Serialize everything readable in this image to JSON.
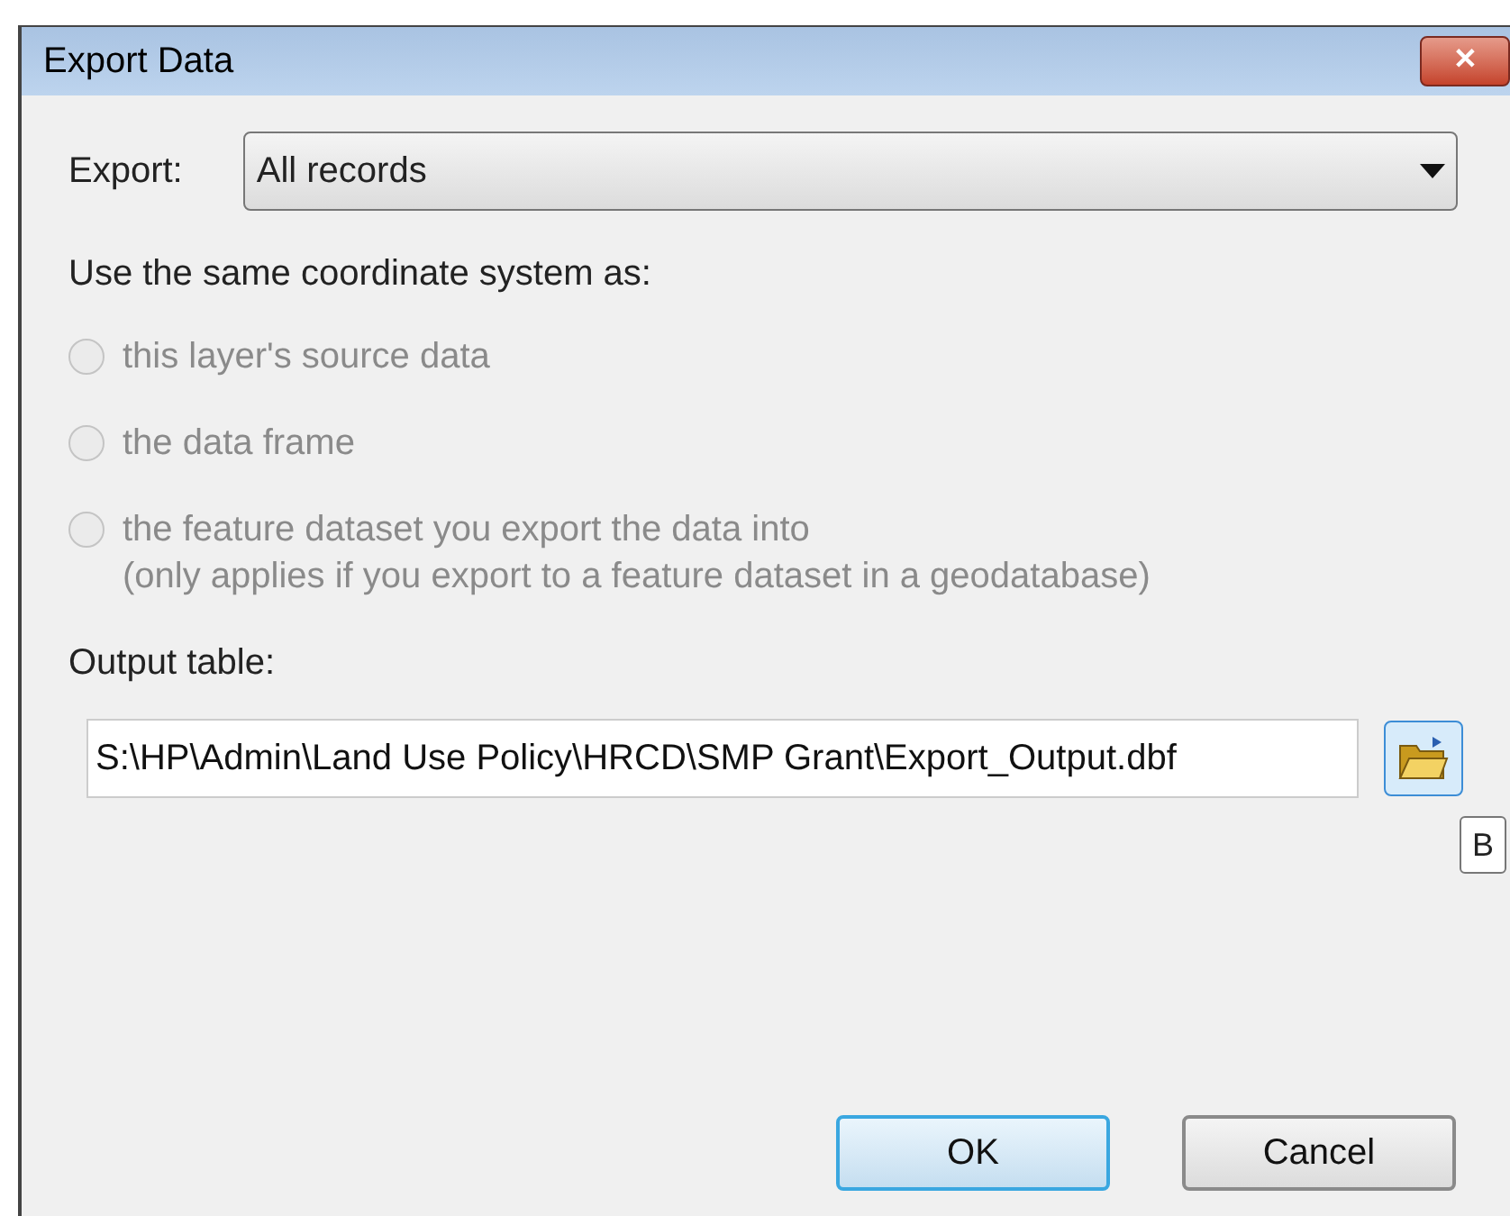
{
  "window": {
    "title": "Export Data",
    "close_glyph": "✕"
  },
  "export": {
    "label": "Export:",
    "value": "All records"
  },
  "coordinate_label": "Use the same coordinate system as:",
  "options": [
    {
      "label": "this layer's source data",
      "selected": false,
      "disabled": true
    },
    {
      "label": "the data frame",
      "selected": false,
      "disabled": true
    },
    {
      "label": "the feature dataset you export the data into",
      "note": "(only applies if you export to a feature dataset in a geodatabase)",
      "selected": false,
      "disabled": true
    }
  ],
  "output": {
    "label": "Output table:",
    "value": "S:\\HP\\Admin\\Land Use Policy\\HRCD\\SMP Grant\\Export_Output.dbf"
  },
  "tooltip": "B",
  "buttons": [
    {
      "label": "OK",
      "default": true
    },
    {
      "label": "Cancel",
      "default": false
    }
  ]
}
